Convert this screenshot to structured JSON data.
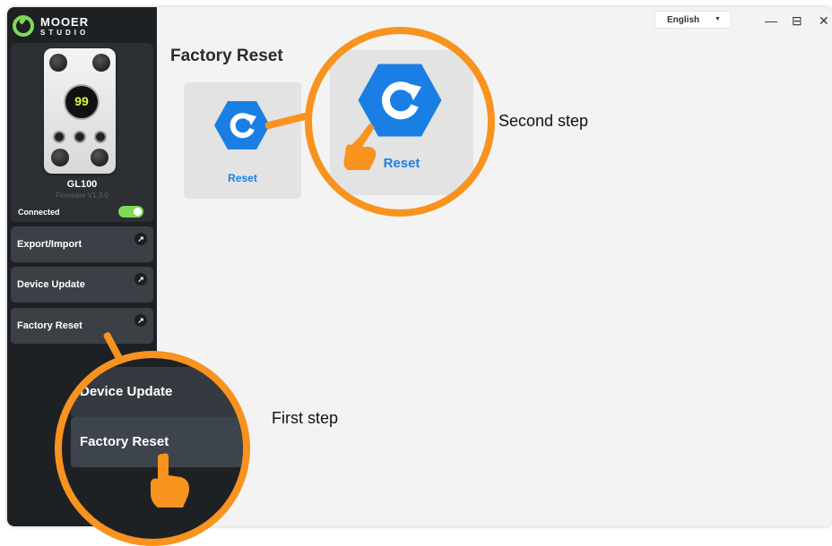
{
  "brand": {
    "name": "MOOER",
    "sub": "STUDIO"
  },
  "device": {
    "screen_value": "99",
    "name": "GL100",
    "firmware": "Firmware V1.3.0",
    "status": "Connected",
    "connected": true
  },
  "sidebar": {
    "items": [
      {
        "label": "Export/Import"
      },
      {
        "label": "Device Update"
      },
      {
        "label": "Factory Reset"
      }
    ],
    "arrow_glyph": "↗"
  },
  "header": {
    "language": "English",
    "language_caret": "▼",
    "window_controls": {
      "minimize": "—",
      "maximize": "⊟",
      "close": "✕"
    }
  },
  "main": {
    "title": "Factory  Reset",
    "reset_card": {
      "label": "Reset",
      "icon": "reset-hexagon-icon"
    }
  },
  "callouts": {
    "second": {
      "label": "Reset",
      "text": "Second step"
    },
    "first": {
      "items": [
        "Device Update",
        "Factory Reset"
      ],
      "text": "First step"
    }
  },
  "colors": {
    "accent_green": "#7ed957",
    "reset_blue": "#1a7fe5",
    "callout_orange": "#f7931e",
    "sidebar_bg": "#1e2124"
  }
}
